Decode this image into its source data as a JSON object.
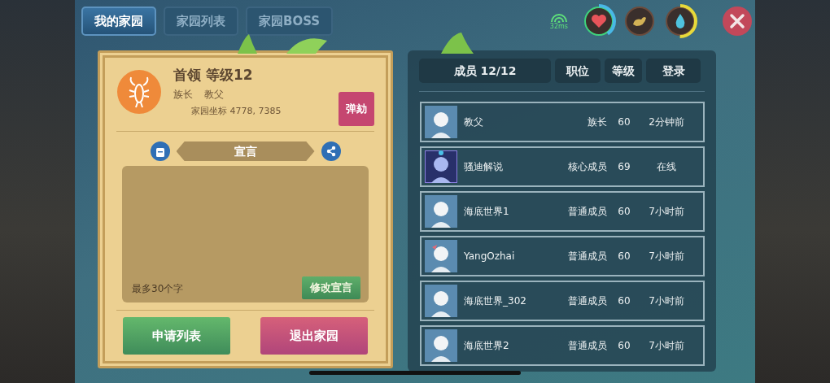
{
  "tabs": [
    {
      "label": "我的家园",
      "selected": true
    },
    {
      "label": "家园列表",
      "selected": false
    },
    {
      "label": "家园BOSS",
      "selected": false
    }
  ],
  "status": {
    "ping": "32ms",
    "meters": [
      {
        "kind": "heart"
      },
      {
        "kind": "food"
      },
      {
        "kind": "water"
      }
    ]
  },
  "home": {
    "title": "首领 等级12",
    "leader_label": "族长",
    "leader_name": "教父",
    "coords": "家园坐标 4778, 7385",
    "impeach_button": "弹劾",
    "manifesto": {
      "title": "宣言",
      "placeholder": "最多30个字",
      "edit_button": "修改宣言"
    },
    "buttons": [
      {
        "label": "申请列表",
        "kind": "green"
      },
      {
        "label": "退出家园",
        "kind": "pink"
      }
    ]
  },
  "members": {
    "columns": [
      "成员 12/12",
      "职位",
      "等级",
      "登录"
    ],
    "rows": [
      {
        "name": "教父",
        "role": "族长",
        "level": "60",
        "login": "2分钟前",
        "kind": "plain"
      },
      {
        "name": "骚迪解说",
        "role": "核心成员",
        "level": "69",
        "login": "在线",
        "kind": "framed"
      },
      {
        "name": "海底世界1",
        "role": "普通成员",
        "level": "60",
        "login": "7小时前",
        "kind": "plain"
      },
      {
        "name": "YangOzhai",
        "role": "普通成员",
        "level": "60",
        "login": "7小时前",
        "kind": "bow"
      },
      {
        "name": "海底世界_302",
        "role": "普通成员",
        "level": "60",
        "login": "7小时前",
        "kind": "plain"
      },
      {
        "name": "海底世界2",
        "role": "普通成员",
        "level": "60",
        "login": "7小时前",
        "kind": "plain"
      }
    ]
  }
}
